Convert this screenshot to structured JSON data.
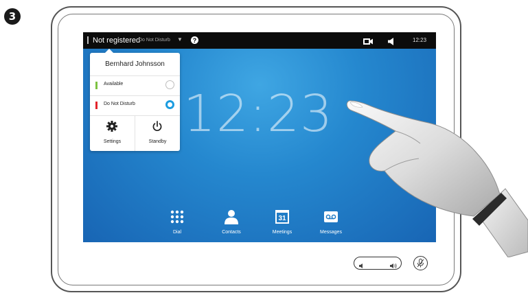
{
  "step": {
    "number": "3"
  },
  "status_bar": {
    "registration": "Not registered",
    "presence": "Do Not Disturb",
    "help_symbol": "?",
    "time": "12:23",
    "icons": [
      "help-icon",
      "camera-icon",
      "speaker-icon"
    ]
  },
  "clock": {
    "time": "12:23"
  },
  "status_menu": {
    "user_name": "Bernhard Johnsson",
    "options": [
      {
        "label": "Available",
        "color": "#7dc242",
        "selected": false
      },
      {
        "label": "Do Not Disturb",
        "color": "#e3242b",
        "selected": true
      }
    ],
    "actions": [
      {
        "label": "Settings",
        "icon": "gear-icon"
      },
      {
        "label": "Standby",
        "icon": "power-icon"
      }
    ]
  },
  "nav": {
    "items": [
      {
        "label": "Dial",
        "icon": "keypad-icon"
      },
      {
        "label": "Contacts",
        "icon": "person-icon"
      },
      {
        "label": "Meetings",
        "icon": "calendar-icon",
        "badge": "31"
      },
      {
        "label": "Messages",
        "icon": "voicemail-icon"
      }
    ]
  },
  "hardware": {
    "volume_icons": [
      "volume-down-icon",
      "volume-up-icon"
    ],
    "mute_icon": "mic-mute-icon"
  },
  "colors": {
    "accent": "#1b9ce0",
    "screen_blue": "#2588cf",
    "status_bar": "#0c0c0c"
  }
}
